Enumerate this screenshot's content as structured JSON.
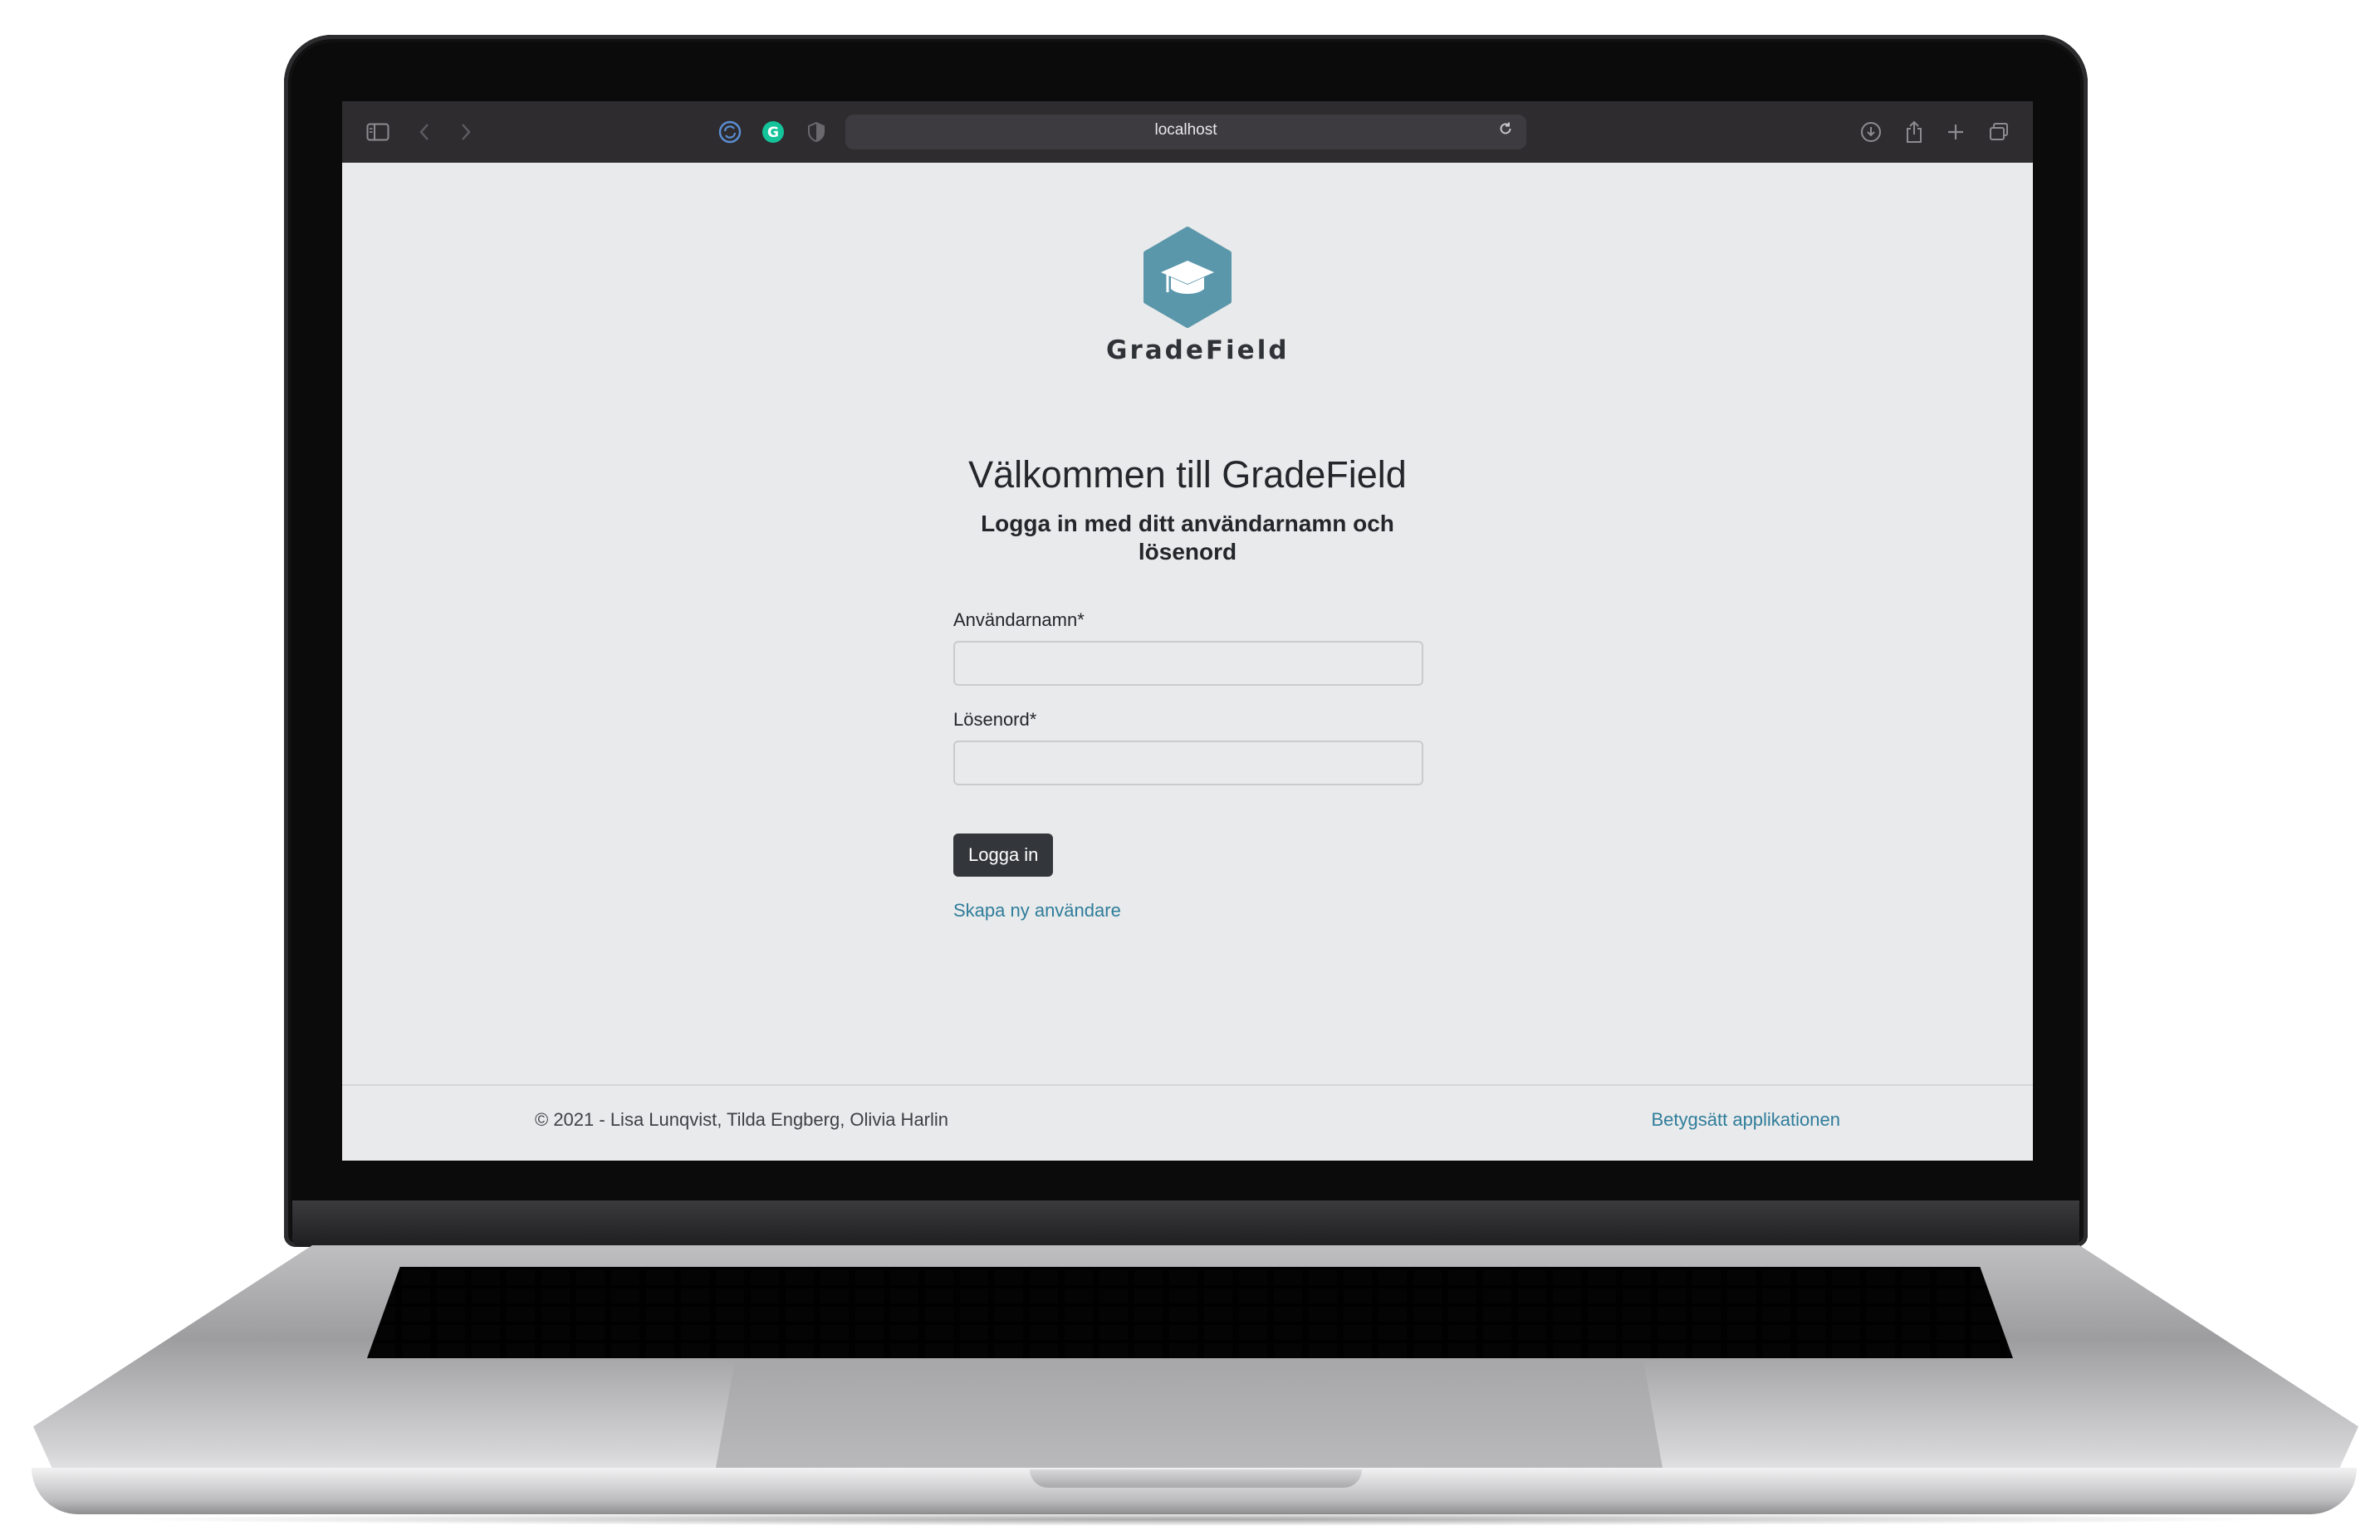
{
  "browser": {
    "url": "localhost"
  },
  "brand": {
    "name": "GradeField",
    "color": "#5a97ab"
  },
  "login": {
    "title": "Välkommen till GradeField",
    "subtitle": "Logga in med ditt användarnamn och lösenord",
    "username_label": "Användarnamn*",
    "username_value": "",
    "password_label": "Lösenord*",
    "password_value": "",
    "submit_label": "Logga in",
    "create_user_link": "Skapa ny användare"
  },
  "footer": {
    "copyright": "© 2021 - Lisa Lunqvist, Tilda Engberg, Olivia Harlin",
    "rate_link": "Betygsätt applikationen"
  },
  "colors": {
    "link": "#2f7d9b",
    "button": "#33363b",
    "page_bg": "#e9eaeb",
    "toolbar_bg": "#2e2c2f"
  },
  "icons": {
    "sidebar": "sidebar-icon",
    "back": "chevron-left-icon",
    "forward": "chevron-right-icon",
    "extensions": [
      "sync-extension-icon",
      "grammarly-icon",
      "shield-icon"
    ],
    "reload": "reload-icon",
    "right": [
      "download-icon",
      "share-icon",
      "new-tab-icon",
      "tabs-overview-icon"
    ]
  }
}
